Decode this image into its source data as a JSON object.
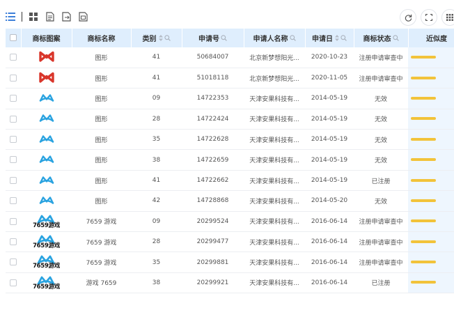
{
  "toolbar": {
    "left_icons": [
      "list-view-icon",
      "grid-view-icon",
      "doc-icon",
      "export-icon",
      "copy-icon"
    ],
    "right_icons": [
      "refresh-icon",
      "fullscreen-icon",
      "columns-icon"
    ]
  },
  "table": {
    "columns": {
      "logo": "商标图案",
      "name": "商标名称",
      "class": "类别",
      "reg_no": "申请号",
      "applicant": "申请人名称",
      "date": "申请日",
      "status": "商标状态",
      "similarity": "近似度"
    },
    "rows": [
      {
        "logo": "red-mark",
        "name": "图形",
        "class": "41",
        "reg_no": "50684007",
        "applicant": "北京新梦想阳光...",
        "date": "2020-10-23",
        "status": "注册申请审查中"
      },
      {
        "logo": "red-mark",
        "name": "图形",
        "class": "41",
        "reg_no": "51018118",
        "applicant": "北京新梦想阳光...",
        "date": "2020-11-05",
        "status": "注册申请审查中"
      },
      {
        "logo": "blue-mark",
        "name": "图形",
        "class": "09",
        "reg_no": "14722353",
        "applicant": "天津安果科技有...",
        "date": "2014-05-19",
        "status": "无效"
      },
      {
        "logo": "blue-mark",
        "name": "图形",
        "class": "28",
        "reg_no": "14722424",
        "applicant": "天津安果科技有...",
        "date": "2014-05-19",
        "status": "无效"
      },
      {
        "logo": "blue-mark",
        "name": "图形",
        "class": "35",
        "reg_no": "14722628",
        "applicant": "天津安果科技有...",
        "date": "2014-05-19",
        "status": "无效"
      },
      {
        "logo": "blue-mark",
        "name": "图形",
        "class": "38",
        "reg_no": "14722659",
        "applicant": "天津安果科技有...",
        "date": "2014-05-19",
        "status": "无效"
      },
      {
        "logo": "blue-mark",
        "name": "图形",
        "class": "41",
        "reg_no": "14722662",
        "applicant": "天津安果科技有...",
        "date": "2014-05-19",
        "status": "已注册"
      },
      {
        "logo": "blue-mark",
        "name": "图形",
        "class": "42",
        "reg_no": "14728868",
        "applicant": "天津安果科技有...",
        "date": "2014-05-20",
        "status": "无效"
      },
      {
        "logo": "7659-mark",
        "name": "7659 游戏",
        "class": "09",
        "reg_no": "20299524",
        "applicant": "天津安果科技有...",
        "date": "2016-06-14",
        "status": "注册申请审查中"
      },
      {
        "logo": "7659-mark",
        "name": "7659 游戏",
        "class": "28",
        "reg_no": "20299477",
        "applicant": "天津安果科技有...",
        "date": "2016-06-14",
        "status": "注册申请审查中"
      },
      {
        "logo": "7659-mark",
        "name": "7659 游戏",
        "class": "35",
        "reg_no": "20299881",
        "applicant": "天津安果科技有...",
        "date": "2016-06-14",
        "status": "注册申请审查中"
      },
      {
        "logo": "7659-mark",
        "name": "游戏 7659",
        "class": "38",
        "reg_no": "20299921",
        "applicant": "天津安果科技有...",
        "date": "2016-06-14",
        "status": "已注册"
      }
    ]
  },
  "logo_text": "7659游戏",
  "colors": {
    "header_bg": "#dfeefd",
    "similarity_bar": "#f2c33a",
    "red_mark": "#d9362b",
    "blue_mark": "#2aa3e0"
  }
}
